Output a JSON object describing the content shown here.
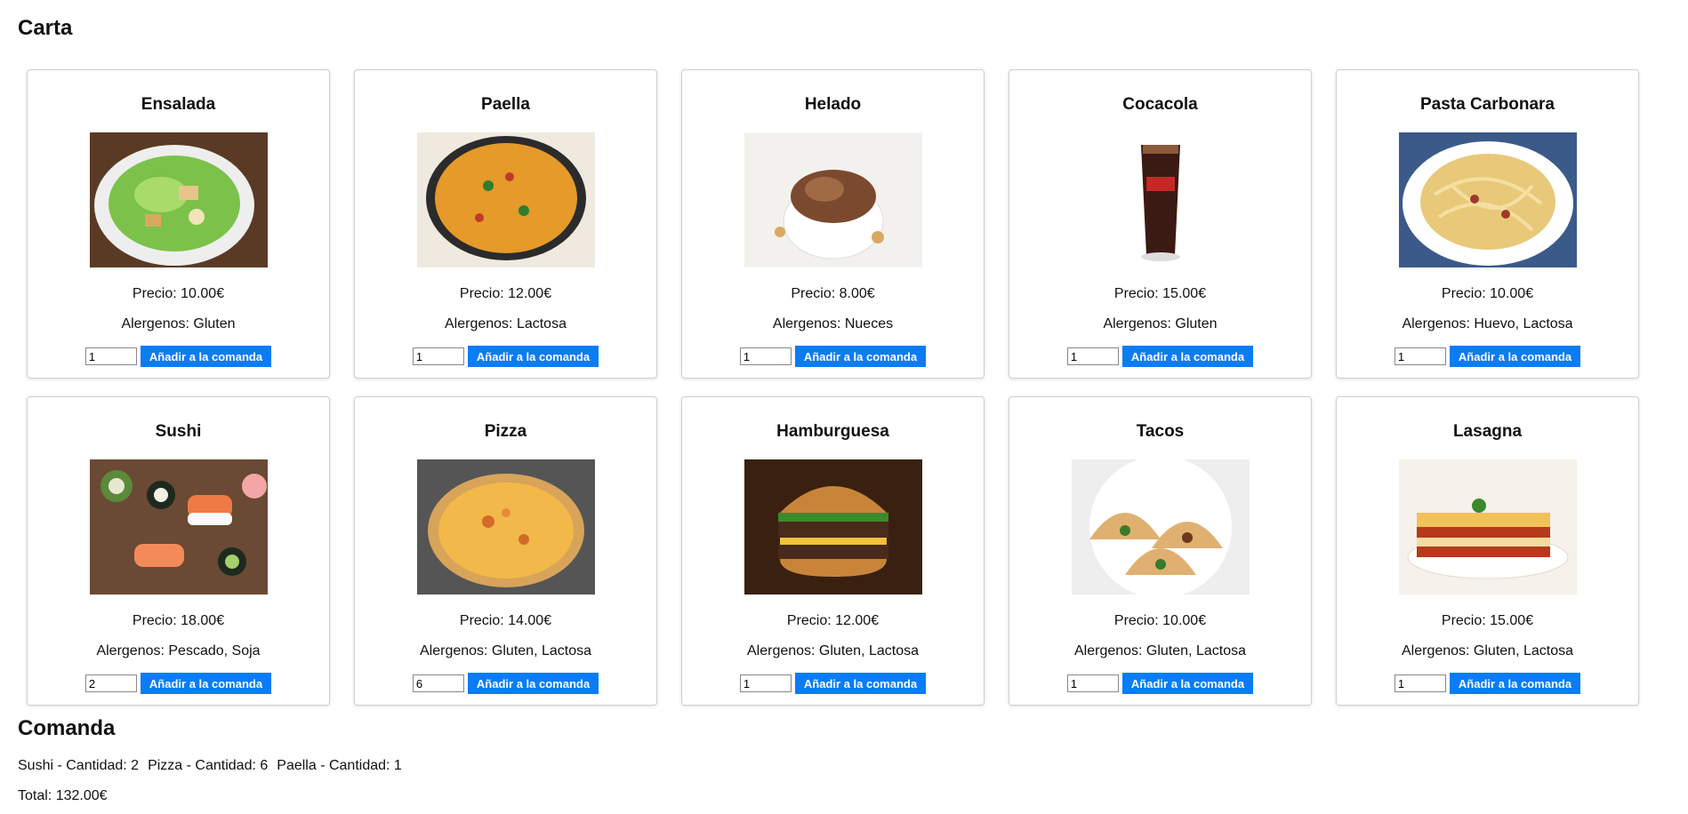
{
  "carta_title": "Carta",
  "comanda_title": "Comanda",
  "add_label": "Añadir a la comanda",
  "products": [
    {
      "name": "Ensalada",
      "price": "Precio: 10.00€",
      "allergens": "Alergenos: Gluten",
      "qty": "1",
      "icon": "salad"
    },
    {
      "name": "Paella",
      "price": "Precio: 12.00€",
      "allergens": "Alergenos: Lactosa",
      "qty": "1",
      "icon": "paella"
    },
    {
      "name": "Helado",
      "price": "Precio: 8.00€",
      "allergens": "Alergenos: Nueces",
      "qty": "1",
      "icon": "ice-cream"
    },
    {
      "name": "Cocacola",
      "price": "Precio: 15.00€",
      "allergens": "Alergenos: Gluten",
      "qty": "1",
      "icon": "cola"
    },
    {
      "name": "Pasta Carbonara",
      "price": "Precio: 10.00€",
      "allergens": "Alergenos: Huevo, Lactosa",
      "qty": "1",
      "icon": "pasta"
    },
    {
      "name": "Sushi",
      "price": "Precio: 18.00€",
      "allergens": "Alergenos: Pescado, Soja",
      "qty": "2",
      "icon": "sushi"
    },
    {
      "name": "Pizza",
      "price": "Precio: 14.00€",
      "allergens": "Alergenos: Gluten, Lactosa",
      "qty": "6",
      "icon": "pizza"
    },
    {
      "name": "Hamburguesa",
      "price": "Precio: 12.00€",
      "allergens": "Alergenos: Gluten, Lactosa",
      "qty": "1",
      "icon": "burger"
    },
    {
      "name": "Tacos",
      "price": "Precio: 10.00€",
      "allergens": "Alergenos: Gluten, Lactosa",
      "qty": "1",
      "icon": "tacos"
    },
    {
      "name": "Lasagna",
      "price": "Precio: 15.00€",
      "allergens": "Alergenos: Gluten, Lactosa",
      "qty": "1",
      "icon": "lasagna"
    }
  ],
  "order_items": [
    "Sushi - Cantidad: 2",
    "Pizza - Cantidad: 6",
    "Paella - Cantidad: 1"
  ],
  "total": "Total: 132.00€"
}
